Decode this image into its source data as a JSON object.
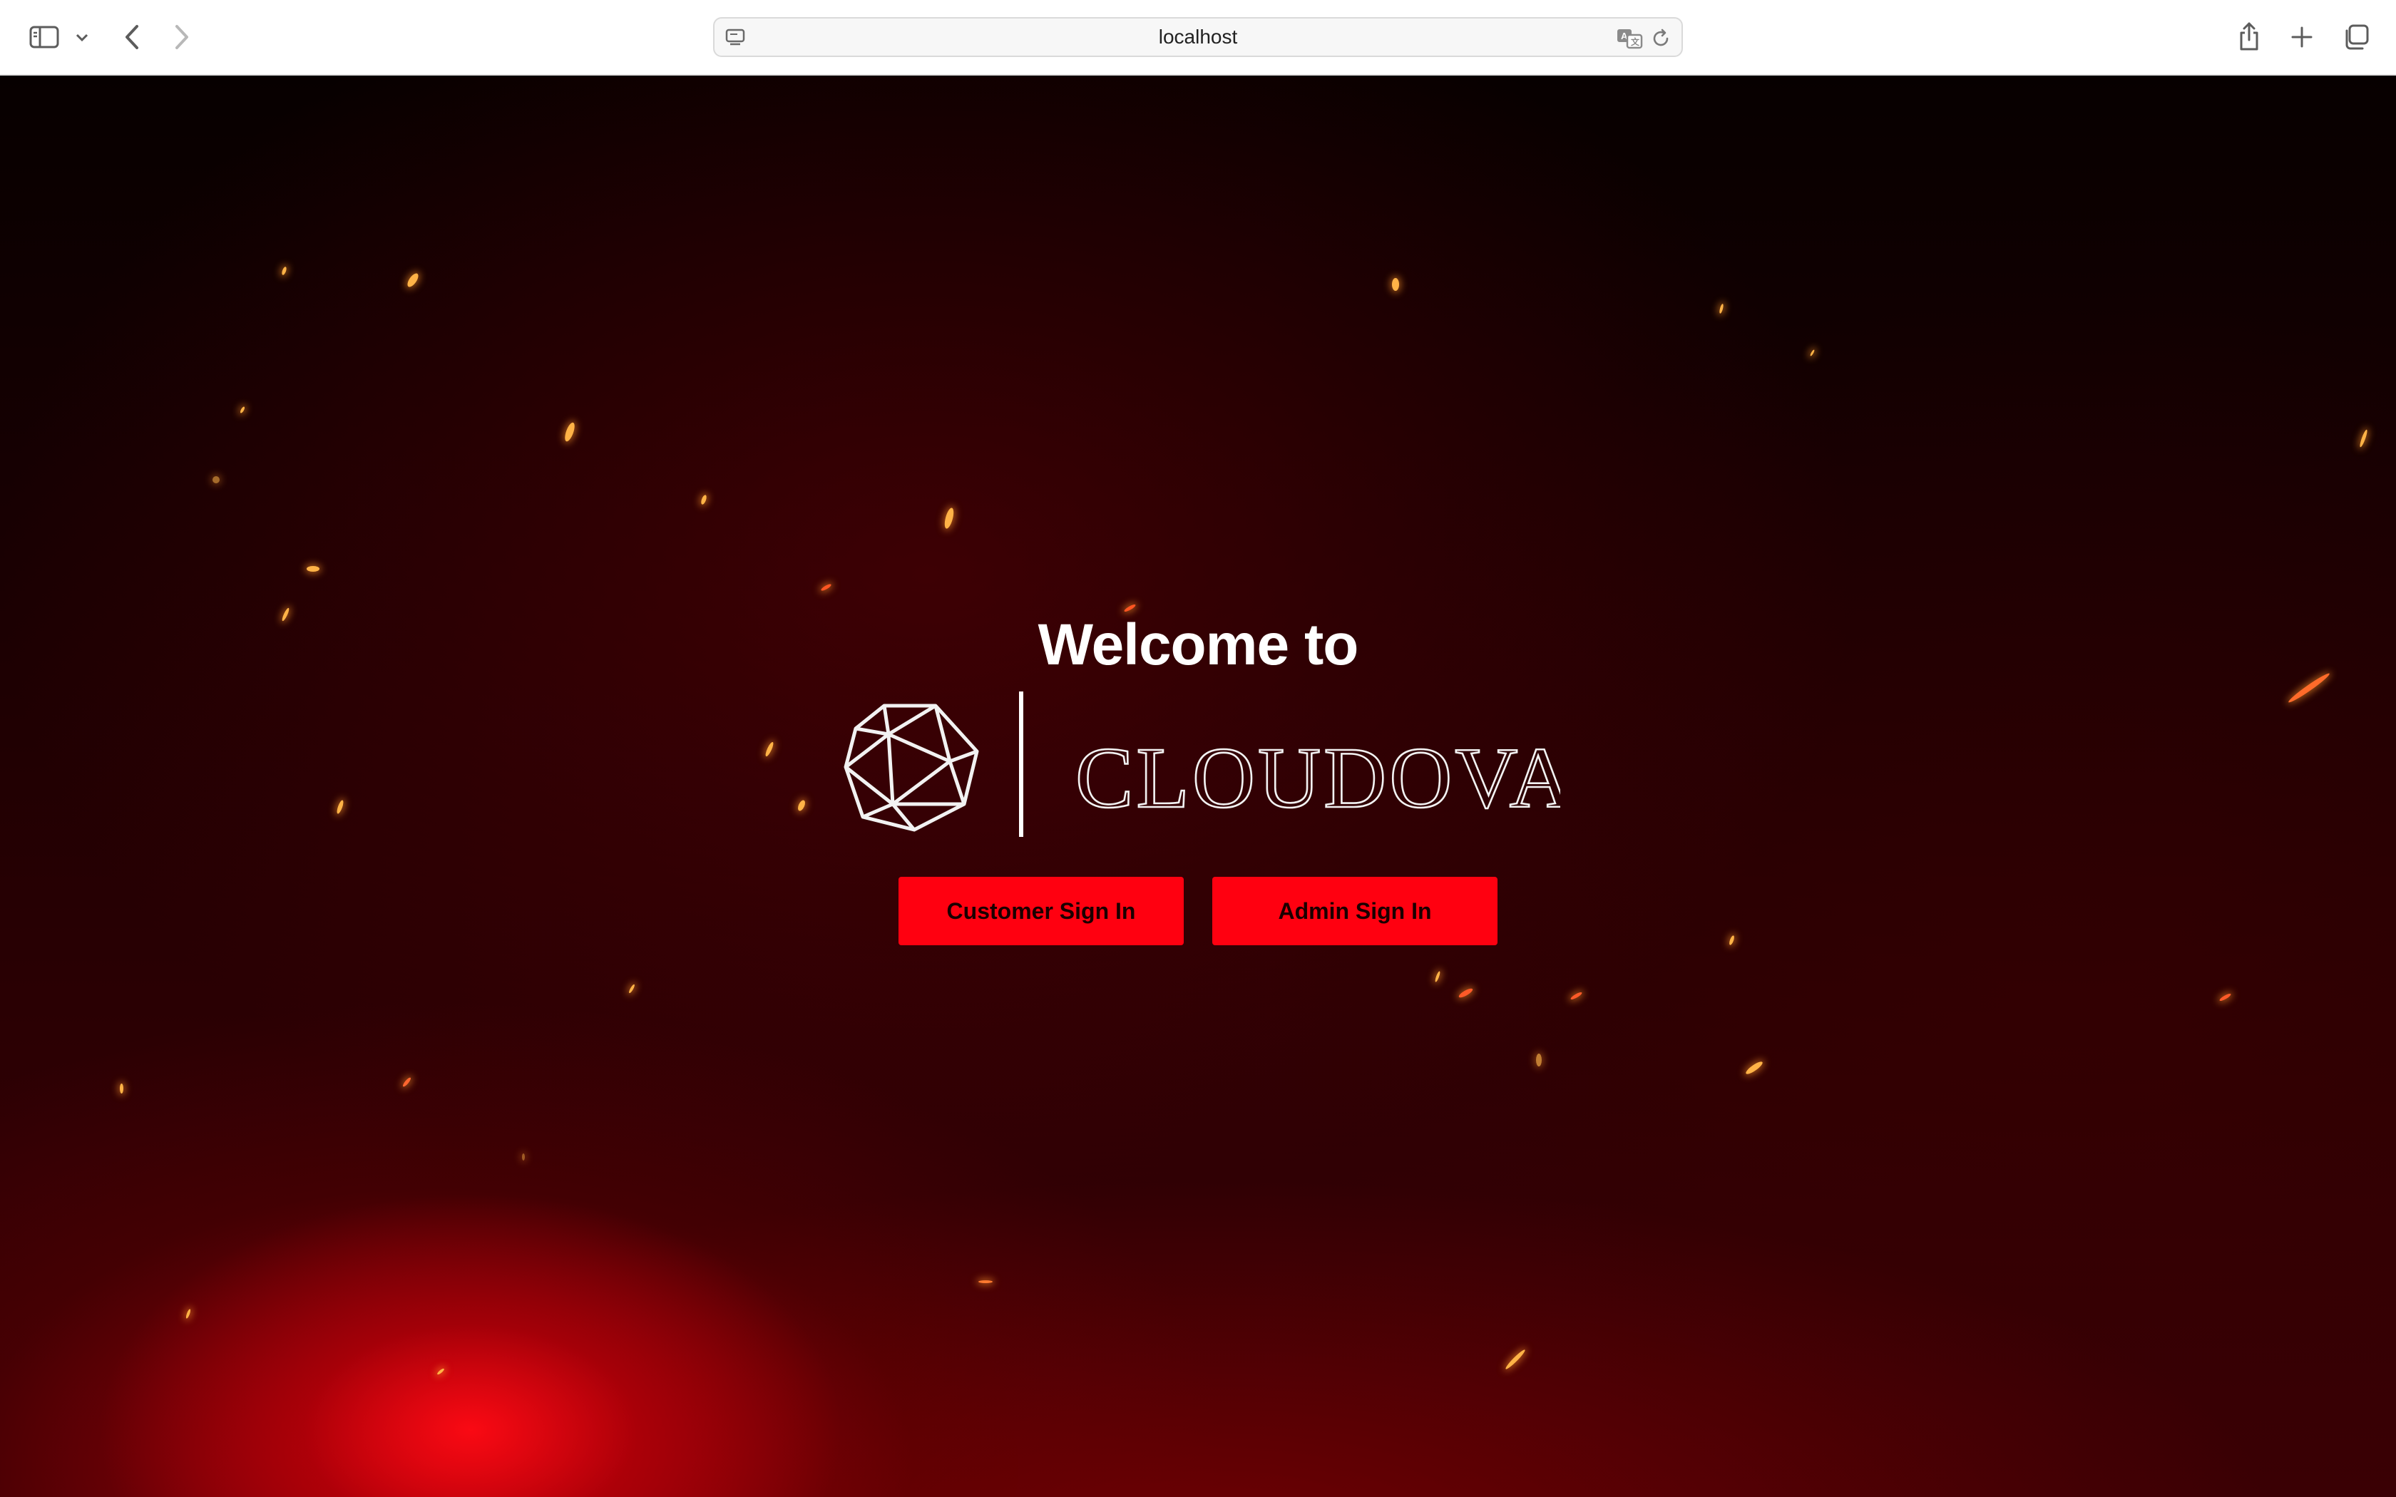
{
  "browser": {
    "url": "localhost"
  },
  "hero": {
    "welcome_text": "Welcome to",
    "brand_name": "CLOUDOVA"
  },
  "buttons": {
    "customer_sign_in": "Customer Sign In",
    "admin_sign_in": "Admin Sign In"
  },
  "colors": {
    "button_bg": "#ff0010",
    "page_bg": "#1a0002",
    "text_primary": "#ffffff"
  }
}
